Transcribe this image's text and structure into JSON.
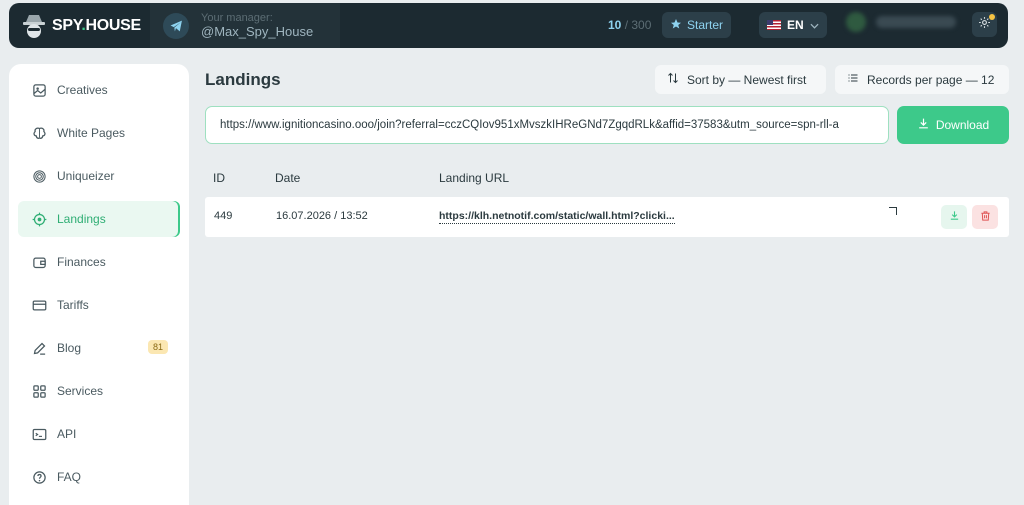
{
  "header": {
    "logo_text": "SPY.HOUSE",
    "manager_label": "Your manager:",
    "manager_name": "@Max_Spy_House",
    "quota_used": "10",
    "quota_total": "/ 300",
    "plan_label": "Starter",
    "language": "EN",
    "icons": [
      "spy-logo-icon",
      "telegram-icon",
      "star-icon",
      "us-flag-icon",
      "chevron-down-icon",
      "gear-icon"
    ]
  },
  "sidebar": {
    "items": [
      {
        "label": "Creatives",
        "icon": "image-icon"
      },
      {
        "label": "White Pages",
        "icon": "brain-icon"
      },
      {
        "label": "Uniqueizer",
        "icon": "fingerprint-icon"
      },
      {
        "label": "Landings",
        "icon": "target-icon",
        "active": true
      },
      {
        "label": "Finances",
        "icon": "wallet-icon"
      },
      {
        "label": "Tariffs",
        "icon": "card-icon"
      },
      {
        "label": "Blog",
        "icon": "pen-icon",
        "badge": "81"
      },
      {
        "label": "Services",
        "icon": "grid-icon"
      },
      {
        "label": "API",
        "icon": "api-icon"
      },
      {
        "label": "FAQ",
        "icon": "question-icon"
      }
    ]
  },
  "main": {
    "title": "Landings",
    "sort_label": "Sort by — Newest first",
    "records_label": "Records per page — 12",
    "url_value": "https://www.ignitioncasino.ooo/join?referral=cczCQIov951xMvszkIHReGNd7ZgqdRLk&affid=37583&utm_source=spn-rll-a",
    "download_label": "Download",
    "table": {
      "headers": [
        "ID",
        "Date",
        "Landing URL"
      ],
      "rows": [
        {
          "id": "449",
          "date": "16.07.2026 / 13:52",
          "url": "https://klh.netnotif.com/static/wall.html?clicki..."
        }
      ]
    }
  },
  "colors": {
    "accent": "#3dc98a",
    "topbar": "#1c2a31",
    "background": "#e9edef",
    "delete": "#e05555"
  }
}
